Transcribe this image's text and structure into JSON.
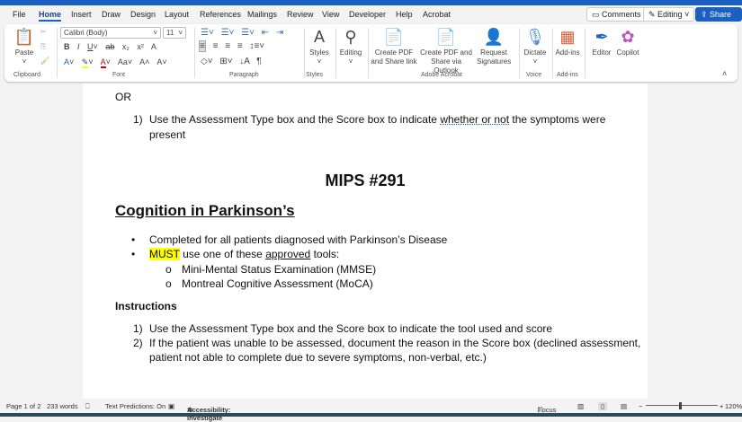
{
  "menu": {
    "tabs": [
      "File",
      "Home",
      "Insert",
      "Draw",
      "Design",
      "Layout",
      "References",
      "Mailings",
      "Review",
      "View",
      "Developer",
      "Help",
      "Acrobat"
    ],
    "comments": "Comments",
    "editing": "Editing",
    "share": "Share"
  },
  "ribbon": {
    "paste": "Paste",
    "font_name": "Calibri (Body)",
    "font_size": "11",
    "styles": "Styles",
    "editing": "Editing",
    "create_pdf_link": "Create PDF and Share link",
    "create_pdf_outlook": "Create PDF and Share via Outlook",
    "request_signatures": "Request Signatures",
    "dictate": "Dictate",
    "addins": "Add-ins",
    "editor": "Editor",
    "copilot": "Copilot",
    "groups": {
      "clipboard": "Clipboard",
      "font": "Font",
      "paragraph": "Paragraph",
      "styles": "Styles",
      "acrobat": "Adobe Acrobat",
      "voice": "Voice",
      "addins": "Add-ins"
    }
  },
  "doc": {
    "or": "OR",
    "top_item_num": "1)",
    "top_item_a": "Use the Assessment Type box and the Score box to indicate ",
    "top_item_u": "whether or not",
    "top_item_b": " the symptoms were",
    "top_item_c": "present",
    "title": "MIPS #291",
    "heading": "Cognition in Parkinson’s",
    "bullet1": "Completed for all patients diagnosed with Parkinson’s Disease",
    "bullet2_hl": "MUST",
    "bullet2_a": " use one of these ",
    "bullet2_u": "approved",
    "bullet2_b": " tools:",
    "sub1": "Mini-Mental Status Examination (MMSE)",
    "sub2": "Montreal Cognitive Assessment (MoCA)",
    "instructions": "Instructions",
    "i1_num": "1)",
    "i1": "Use the Assessment Type box and the Score box to indicate the tool used and score",
    "i2_num": "2)",
    "i2a": "If the patient was unable to be assessed, document the reason in the Score box (declined assessment,",
    "i2b": "patient not able to complete due to severe symptoms, non-verbal, etc.)"
  },
  "status": {
    "page": "Page 1 of 2",
    "words": "233 words",
    "predictions": "Text Predictions: On",
    "accessibility": "Accessibility: Investigate",
    "focus": "Focus",
    "zoom": "120%"
  }
}
